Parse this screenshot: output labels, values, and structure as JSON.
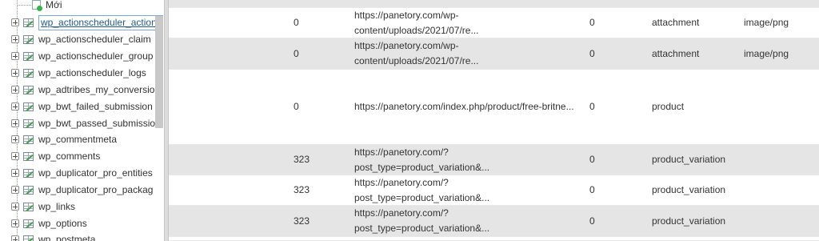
{
  "sidebar": {
    "new_item": "Mới",
    "tables": [
      {
        "label": "wp_actionscheduler_actions",
        "selected": true
      },
      {
        "label": "wp_actionscheduler_claim"
      },
      {
        "label": "wp_actionscheduler_group"
      },
      {
        "label": "wp_actionscheduler_logs"
      },
      {
        "label": "wp_adtribes_my_conversio"
      },
      {
        "label": "wp_bwt_failed_submission"
      },
      {
        "label": "wp_bwt_passed_submissio"
      },
      {
        "label": "wp_commentmeta"
      },
      {
        "label": "wp_comments"
      },
      {
        "label": "wp_duplicator_pro_entities"
      },
      {
        "label": "wp_duplicator_pro_packag"
      },
      {
        "label": "wp_links"
      },
      {
        "label": "wp_options"
      },
      {
        "label": "wp_postmeta"
      }
    ]
  },
  "grid": {
    "rows": [
      {
        "post_parent": "0",
        "guid": "https://panetory.com/wp-\ncontent/uploads/2021/07/re...",
        "menu_order": "0",
        "post_type": "attachment",
        "post_mime_type": "image/png"
      },
      {
        "post_parent": "0",
        "guid": "https://panetory.com/wp-\ncontent/uploads/2021/07/re...",
        "menu_order": "0",
        "post_type": "attachment",
        "post_mime_type": "image/png"
      },
      {
        "post_parent": "0",
        "guid": "https://panetory.com/index.php/product/free-britne...",
        "menu_order": "0",
        "post_type": "product",
        "post_mime_type": ""
      },
      {
        "post_parent": "323",
        "guid": "https://panetory.com/?\npost_type=product_variation&...",
        "menu_order": "0",
        "post_type": "product_variation",
        "post_mime_type": ""
      },
      {
        "post_parent": "323",
        "guid": "https://panetory.com/?\npost_type=product_variation&...",
        "menu_order": "0",
        "post_type": "product_variation",
        "post_mime_type": ""
      },
      {
        "post_parent": "323",
        "guid": "https://panetory.com/?\npost_type=product_variation&...",
        "menu_order": "0",
        "post_type": "product_variation",
        "post_mime_type": ""
      }
    ]
  }
}
